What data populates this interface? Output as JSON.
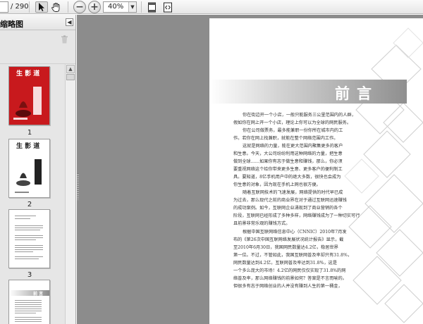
{
  "toolbar": {
    "page_total": "/ 290",
    "zoom": "40%",
    "icons": [
      "select-arrow-icon",
      "hand-icon",
      "zoom-out-icon",
      "zoom-in-icon",
      "fit-page-icon",
      "fit-width-icon",
      "dropdown-icon"
    ]
  },
  "sidebar": {
    "title": "缩略图",
    "thumbnails": [
      {
        "label": "1",
        "cover_title": "生 影 道"
      },
      {
        "label": "2",
        "cover_title": "生 影 道"
      },
      {
        "label": "3"
      },
      {
        "label": "",
        "banner": "前 言"
      }
    ]
  },
  "document": {
    "heading": "前言",
    "lines": [
      "你在街边开一个小店，一般只能服务三公里范围内的人群，",
      "假如你在网上开一个小店，理论上你可以为全球的网民服务。",
      "你在公司做票务，最多能兼职一份你所在城市内的工",
      "作。若你在网上找兼职，就能在整个网络范围内工作。",
      "这就是网络的力量，能在更大范围内聚集更多的客户",
      "和生意。今天，大公司纷纷利用这种网络的力量，把生意",
      "做到全球……如果你有志于做生意和赚钱，那么，你必须",
      "要重视网络这个给你带来更多生意、更多客户的便利制工",
      "具。要知道，8亿手机用户中的绝大多数，很快也会成为",
      "你生意的对象，因为现在手机上网也很方便。",
      "随着互联网技术的飞速发展，网络提供的时代早已成",
      "为过去，那么现代之前的商业界在对于通过互联网迅速赚钱",
      "的成功案例。如今，互联网企业涌现到了商业营销的各个",
      "阶段，互联网已经形成了多种多样，网络赚钱成为了一种切实可行",
      "且前景非常乐观的赚钱方式。",
      "根据中国互联网络信息中心（CNNIC）2010年7月发",
      "布的《第26次中国互联网络发展状况统计报告》显示，截",
      "至2010年6月30日，我国网民数量达4.2亿，稳居世界",
      "第一位。不过，不管如此，我国互联网普及率却只有31.8%，",
      "网民数量达到4.2亿，互联网普及率达到31.8%，这是",
      "一个多么庞大的市场！4.2亿的网民仅仅实现了31.8%的网",
      "络普及率，那么网络赚钱的前景如何？答案是不言而喻的。",
      "但很多有志于网络创业的人并没有赚到人生的第一桶金，"
    ]
  }
}
